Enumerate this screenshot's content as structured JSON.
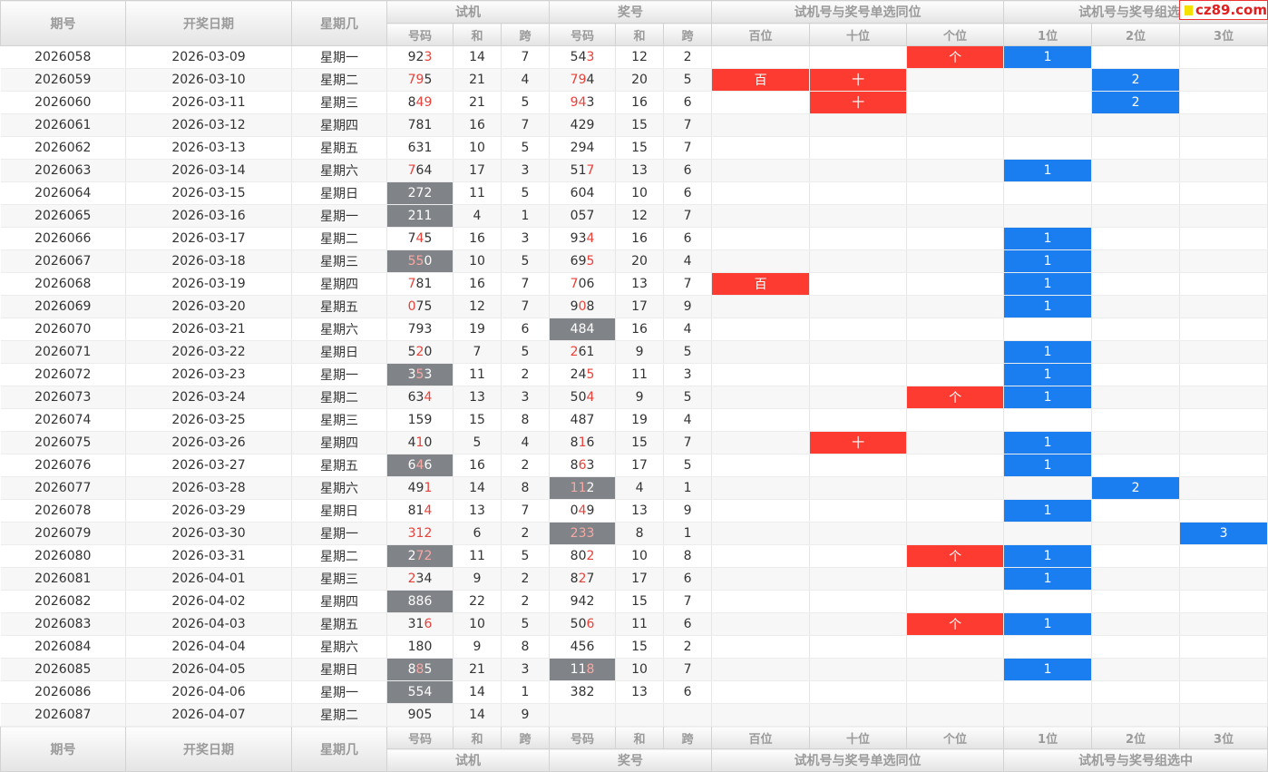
{
  "header": {
    "col_issue": "期号",
    "col_date": "开奖日期",
    "col_weekday": "星期几",
    "group_trial": "试机",
    "group_prize": "奖号",
    "group_single": "试机号与奖号单选同位",
    "group_combo": "试机号与奖号组选中",
    "sub_code": "号码",
    "sub_sum": "和",
    "sub_span": "跨",
    "pos_hundred": "百位",
    "pos_ten": "十位",
    "pos_unit": "个位",
    "combo_1": "1位",
    "combo_2": "2位",
    "combo_3": "3位"
  },
  "logo": {
    "text": "cz89.com",
    "brand_color": "#e02020"
  },
  "colors": {
    "gray": "#808387",
    "red": "#fe3b30",
    "blue": "#1b7ef0"
  },
  "rows": [
    {
      "issue": "2026058",
      "date": "2026-03-09",
      "weekday": "星期一",
      "t": "923",
      "thl": [
        2
      ],
      "tsum": "14",
      "tspan": "7",
      "tg": false,
      "p": "543",
      "phl": [
        2
      ],
      "psum": "12",
      "pspan": "2",
      "pg": false,
      "h": "",
      "te": "",
      "u": "个",
      "c1": "1",
      "c2": "",
      "c3": ""
    },
    {
      "issue": "2026059",
      "date": "2026-03-10",
      "weekday": "星期二",
      "t": "795",
      "thl": [
        0,
        1
      ],
      "tsum": "21",
      "tspan": "4",
      "tg": false,
      "p": "794",
      "phl": [
        0,
        1
      ],
      "psum": "20",
      "pspan": "5",
      "pg": false,
      "h": "百",
      "te": "十",
      "u": "",
      "c1": "",
      "c2": "2",
      "c3": ""
    },
    {
      "issue": "2026060",
      "date": "2026-03-11",
      "weekday": "星期三",
      "t": "849",
      "thl": [
        1,
        2
      ],
      "tsum": "21",
      "tspan": "5",
      "tg": false,
      "p": "943",
      "phl": [
        0,
        1
      ],
      "psum": "16",
      "pspan": "6",
      "pg": false,
      "h": "",
      "te": "十",
      "u": "",
      "c1": "",
      "c2": "2",
      "c3": ""
    },
    {
      "issue": "2026061",
      "date": "2026-03-12",
      "weekday": "星期四",
      "t": "781",
      "thl": [],
      "tsum": "16",
      "tspan": "7",
      "tg": false,
      "p": "429",
      "phl": [],
      "psum": "15",
      "pspan": "7",
      "pg": false,
      "h": "",
      "te": "",
      "u": "",
      "c1": "",
      "c2": "",
      "c3": ""
    },
    {
      "issue": "2026062",
      "date": "2026-03-13",
      "weekday": "星期五",
      "t": "631",
      "thl": [],
      "tsum": "10",
      "tspan": "5",
      "tg": false,
      "p": "294",
      "phl": [],
      "psum": "15",
      "pspan": "7",
      "pg": false,
      "h": "",
      "te": "",
      "u": "",
      "c1": "",
      "c2": "",
      "c3": ""
    },
    {
      "issue": "2026063",
      "date": "2026-03-14",
      "weekday": "星期六",
      "t": "764",
      "thl": [
        0
      ],
      "tsum": "17",
      "tspan": "3",
      "tg": false,
      "p": "517",
      "phl": [
        2
      ],
      "psum": "13",
      "pspan": "6",
      "pg": false,
      "h": "",
      "te": "",
      "u": "",
      "c1": "1",
      "c2": "",
      "c3": ""
    },
    {
      "issue": "2026064",
      "date": "2026-03-15",
      "weekday": "星期日",
      "t": "272",
      "thl": [],
      "tsum": "11",
      "tspan": "5",
      "tg": true,
      "p": "604",
      "phl": [],
      "psum": "10",
      "pspan": "6",
      "pg": false,
      "h": "",
      "te": "",
      "u": "",
      "c1": "",
      "c2": "",
      "c3": ""
    },
    {
      "issue": "2026065",
      "date": "2026-03-16",
      "weekday": "星期一",
      "t": "211",
      "thl": [],
      "tsum": "4",
      "tspan": "1",
      "tg": true,
      "p": "057",
      "phl": [],
      "psum": "12",
      "pspan": "7",
      "pg": false,
      "h": "",
      "te": "",
      "u": "",
      "c1": "",
      "c2": "",
      "c3": ""
    },
    {
      "issue": "2026066",
      "date": "2026-03-17",
      "weekday": "星期二",
      "t": "745",
      "thl": [
        1
      ],
      "tsum": "16",
      "tspan": "3",
      "tg": false,
      "p": "934",
      "phl": [
        2
      ],
      "psum": "16",
      "pspan": "6",
      "pg": false,
      "h": "",
      "te": "",
      "u": "",
      "c1": "1",
      "c2": "",
      "c3": ""
    },
    {
      "issue": "2026067",
      "date": "2026-03-18",
      "weekday": "星期三",
      "t": "550",
      "thl": [
        0,
        1
      ],
      "tsum": "10",
      "tspan": "5",
      "tg": true,
      "p": "695",
      "phl": [
        2
      ],
      "psum": "20",
      "pspan": "4",
      "pg": false,
      "h": "",
      "te": "",
      "u": "",
      "c1": "1",
      "c2": "",
      "c3": ""
    },
    {
      "issue": "2026068",
      "date": "2026-03-19",
      "weekday": "星期四",
      "t": "781",
      "thl": [
        0
      ],
      "tsum": "16",
      "tspan": "7",
      "tg": false,
      "p": "706",
      "phl": [
        0
      ],
      "psum": "13",
      "pspan": "7",
      "pg": false,
      "h": "百",
      "te": "",
      "u": "",
      "c1": "1",
      "c2": "",
      "c3": ""
    },
    {
      "issue": "2026069",
      "date": "2026-03-20",
      "weekday": "星期五",
      "t": "075",
      "thl": [
        0
      ],
      "tsum": "12",
      "tspan": "7",
      "tg": false,
      "p": "908",
      "phl": [
        1
      ],
      "psum": "17",
      "pspan": "9",
      "pg": false,
      "h": "",
      "te": "",
      "u": "",
      "c1": "1",
      "c2": "",
      "c3": ""
    },
    {
      "issue": "2026070",
      "date": "2026-03-21",
      "weekday": "星期六",
      "t": "793",
      "thl": [],
      "tsum": "19",
      "tspan": "6",
      "tg": false,
      "p": "484",
      "phl": [],
      "psum": "16",
      "pspan": "4",
      "pg": true,
      "h": "",
      "te": "",
      "u": "",
      "c1": "",
      "c2": "",
      "c3": ""
    },
    {
      "issue": "2026071",
      "date": "2026-03-22",
      "weekday": "星期日",
      "t": "520",
      "thl": [
        1
      ],
      "tsum": "7",
      "tspan": "5",
      "tg": false,
      "p": "261",
      "phl": [
        0
      ],
      "psum": "9",
      "pspan": "5",
      "pg": false,
      "h": "",
      "te": "",
      "u": "",
      "c1": "1",
      "c2": "",
      "c3": ""
    },
    {
      "issue": "2026072",
      "date": "2026-03-23",
      "weekday": "星期一",
      "t": "353",
      "thl": [
        1
      ],
      "tsum": "11",
      "tspan": "2",
      "tg": true,
      "p": "245",
      "phl": [
        2
      ],
      "psum": "11",
      "pspan": "3",
      "pg": false,
      "h": "",
      "te": "",
      "u": "",
      "c1": "1",
      "c2": "",
      "c3": ""
    },
    {
      "issue": "2026073",
      "date": "2026-03-24",
      "weekday": "星期二",
      "t": "634",
      "thl": [
        2
      ],
      "tsum": "13",
      "tspan": "3",
      "tg": false,
      "p": "504",
      "phl": [
        2
      ],
      "psum": "9",
      "pspan": "5",
      "pg": false,
      "h": "",
      "te": "",
      "u": "个",
      "c1": "1",
      "c2": "",
      "c3": ""
    },
    {
      "issue": "2026074",
      "date": "2026-03-25",
      "weekday": "星期三",
      "t": "159",
      "thl": [],
      "tsum": "15",
      "tspan": "8",
      "tg": false,
      "p": "487",
      "phl": [],
      "psum": "19",
      "pspan": "4",
      "pg": false,
      "h": "",
      "te": "",
      "u": "",
      "c1": "",
      "c2": "",
      "c3": ""
    },
    {
      "issue": "2026075",
      "date": "2026-03-26",
      "weekday": "星期四",
      "t": "410",
      "thl": [
        1
      ],
      "tsum": "5",
      "tspan": "4",
      "tg": false,
      "p": "816",
      "phl": [
        1
      ],
      "psum": "15",
      "pspan": "7",
      "pg": false,
      "h": "",
      "te": "十",
      "u": "",
      "c1": "1",
      "c2": "",
      "c3": ""
    },
    {
      "issue": "2026076",
      "date": "2026-03-27",
      "weekday": "星期五",
      "t": "646",
      "thl": [
        1
      ],
      "tsum": "16",
      "tspan": "2",
      "tg": true,
      "p": "863",
      "phl": [
        1
      ],
      "psum": "17",
      "pspan": "5",
      "pg": false,
      "h": "",
      "te": "",
      "u": "",
      "c1": "1",
      "c2": "",
      "c3": ""
    },
    {
      "issue": "2026077",
      "date": "2026-03-28",
      "weekday": "星期六",
      "t": "491",
      "thl": [
        2
      ],
      "tsum": "14",
      "tspan": "8",
      "tg": false,
      "p": "112",
      "phl": [
        0,
        1
      ],
      "psum": "4",
      "pspan": "1",
      "pg": true,
      "h": "",
      "te": "",
      "u": "",
      "c1": "",
      "c2": "2",
      "c3": ""
    },
    {
      "issue": "2026078",
      "date": "2026-03-29",
      "weekday": "星期日",
      "t": "814",
      "thl": [
        2
      ],
      "tsum": "13",
      "tspan": "7",
      "tg": false,
      "p": "049",
      "phl": [
        1
      ],
      "psum": "13",
      "pspan": "9",
      "pg": false,
      "h": "",
      "te": "",
      "u": "",
      "c1": "1",
      "c2": "",
      "c3": ""
    },
    {
      "issue": "2026079",
      "date": "2026-03-30",
      "weekday": "星期一",
      "t": "312",
      "thl": [
        0,
        1,
        2
      ],
      "tsum": "6",
      "tspan": "2",
      "tg": false,
      "p": "233",
      "phl": [
        0,
        1,
        2
      ],
      "psum": "8",
      "pspan": "1",
      "pg": true,
      "h": "",
      "te": "",
      "u": "",
      "c1": "",
      "c2": "",
      "c3": "3"
    },
    {
      "issue": "2026080",
      "date": "2026-03-31",
      "weekday": "星期二",
      "t": "272",
      "thl": [
        1,
        2
      ],
      "tsum": "11",
      "tspan": "5",
      "tg": true,
      "p": "802",
      "phl": [
        2
      ],
      "psum": "10",
      "pspan": "8",
      "pg": false,
      "h": "",
      "te": "",
      "u": "个",
      "c1": "1",
      "c2": "",
      "c3": ""
    },
    {
      "issue": "2026081",
      "date": "2026-04-01",
      "weekday": "星期三",
      "t": "234",
      "thl": [
        0
      ],
      "tsum": "9",
      "tspan": "2",
      "tg": false,
      "p": "827",
      "phl": [
        1
      ],
      "psum": "17",
      "pspan": "6",
      "pg": false,
      "h": "",
      "te": "",
      "u": "",
      "c1": "1",
      "c2": "",
      "c3": ""
    },
    {
      "issue": "2026082",
      "date": "2026-04-02",
      "weekday": "星期四",
      "t": "886",
      "thl": [],
      "tsum": "22",
      "tspan": "2",
      "tg": true,
      "p": "942",
      "phl": [],
      "psum": "15",
      "pspan": "7",
      "pg": false,
      "h": "",
      "te": "",
      "u": "",
      "c1": "",
      "c2": "",
      "c3": ""
    },
    {
      "issue": "2026083",
      "date": "2026-04-03",
      "weekday": "星期五",
      "t": "316",
      "thl": [
        2
      ],
      "tsum": "10",
      "tspan": "5",
      "tg": false,
      "p": "506",
      "phl": [
        2
      ],
      "psum": "11",
      "pspan": "6",
      "pg": false,
      "h": "",
      "te": "",
      "u": "个",
      "c1": "1",
      "c2": "",
      "c3": ""
    },
    {
      "issue": "2026084",
      "date": "2026-04-04",
      "weekday": "星期六",
      "t": "180",
      "thl": [],
      "tsum": "9",
      "tspan": "8",
      "tg": false,
      "p": "456",
      "phl": [],
      "psum": "15",
      "pspan": "2",
      "pg": false,
      "h": "",
      "te": "",
      "u": "",
      "c1": "",
      "c2": "",
      "c3": ""
    },
    {
      "issue": "2026085",
      "date": "2026-04-05",
      "weekday": "星期日",
      "t": "885",
      "thl": [
        1
      ],
      "tsum": "21",
      "tspan": "3",
      "tg": true,
      "p": "118",
      "phl": [
        2
      ],
      "psum": "10",
      "pspan": "7",
      "pg": true,
      "h": "",
      "te": "",
      "u": "",
      "c1": "1",
      "c2": "",
      "c3": ""
    },
    {
      "issue": "2026086",
      "date": "2026-04-06",
      "weekday": "星期一",
      "t": "554",
      "thl": [],
      "tsum": "14",
      "tspan": "1",
      "tg": true,
      "p": "382",
      "phl": [],
      "psum": "13",
      "pspan": "6",
      "pg": false,
      "h": "",
      "te": "",
      "u": "",
      "c1": "",
      "c2": "",
      "c3": ""
    },
    {
      "issue": "2026087",
      "date": "2026-04-07",
      "weekday": "星期二",
      "t": "905",
      "thl": [],
      "tsum": "14",
      "tspan": "9",
      "tg": false,
      "p": "",
      "phl": [],
      "psum": "",
      "pspan": "",
      "pg": false,
      "h": "",
      "te": "",
      "u": "",
      "c1": "",
      "c2": "",
      "c3": ""
    }
  ]
}
